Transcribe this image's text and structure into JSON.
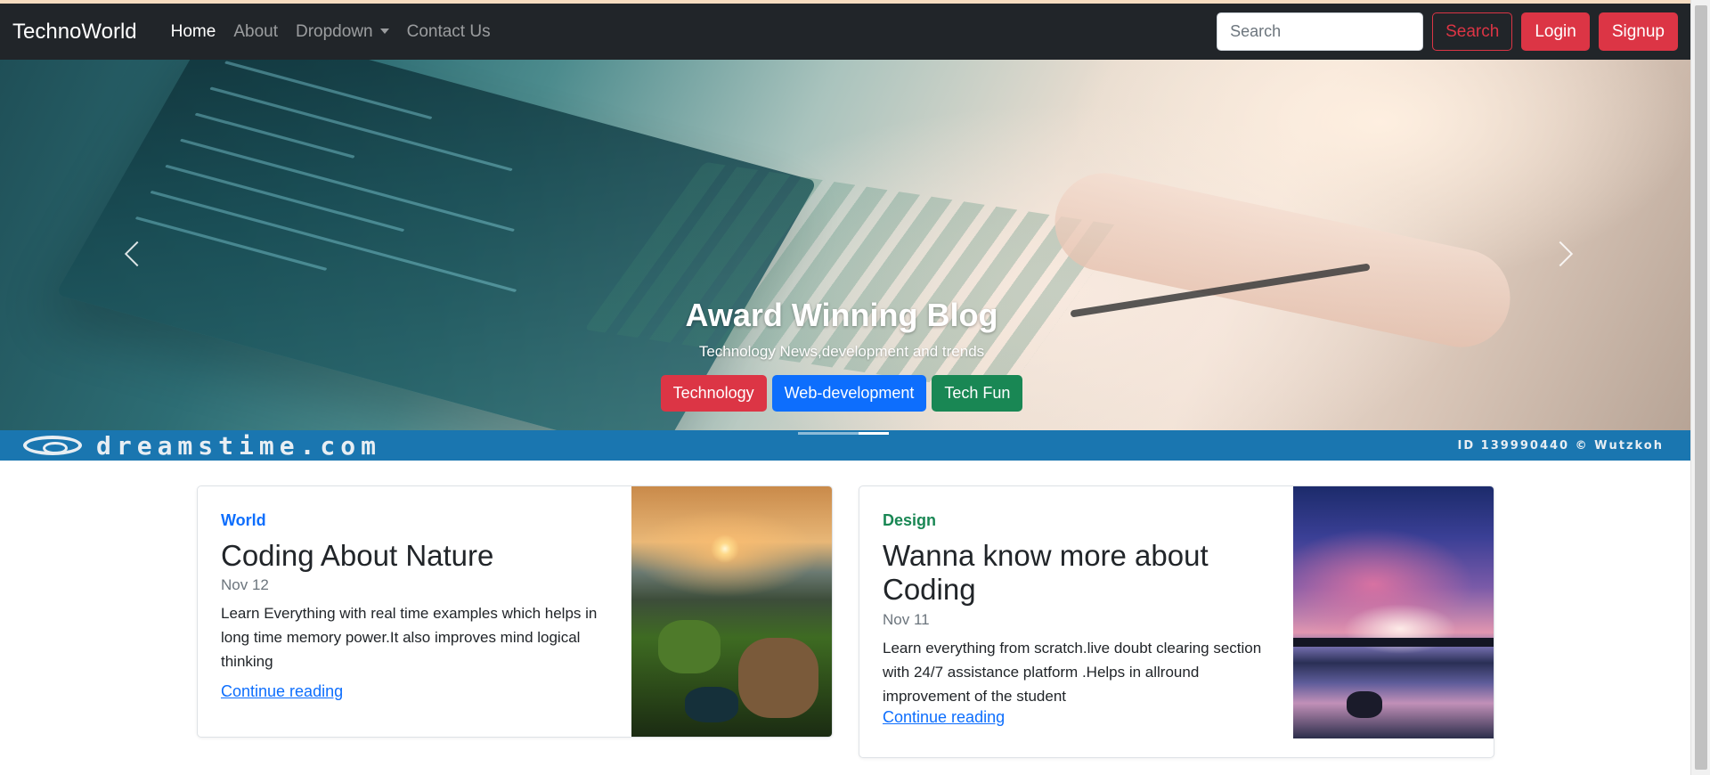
{
  "navbar": {
    "brand": "TechnoWorld",
    "links": [
      "Home",
      "About",
      "Dropdown",
      "Contact Us"
    ],
    "search_placeholder": "Search",
    "search_button": "Search",
    "login_button": "Login",
    "signup_button": "Signup"
  },
  "carousel": {
    "title": "Award Winning Blog",
    "subtitle": "Technology News,development and trends",
    "buttons": [
      "Technology",
      "Web-development",
      "Tech Fun"
    ],
    "watermark_text": "dreamstime.com",
    "watermark_id": "ID 139990440 © Wutzkoh",
    "indicator_count": 3,
    "active_indicator": 3
  },
  "cards": [
    {
      "category": "World",
      "title": "Coding About Nature",
      "date": "Nov 12",
      "text": "Learn Everything with real time examples which helps in long time memory power.It also improves mind logical thinking",
      "link": "Continue reading"
    },
    {
      "category": "Design",
      "title": "Wanna know more about Coding",
      "date": "Nov 11",
      "text": "Learn everything from scratch.live doubt clearing section with 24/7 assistance platform .Helps in allround improvement of the student",
      "link": "Continue reading"
    }
  ],
  "colors": {
    "navbar_bg": "#212529",
    "danger": "#dc3545",
    "primary": "#0d6efd",
    "success": "#198754",
    "watermark_bar": "#1a76b0"
  }
}
